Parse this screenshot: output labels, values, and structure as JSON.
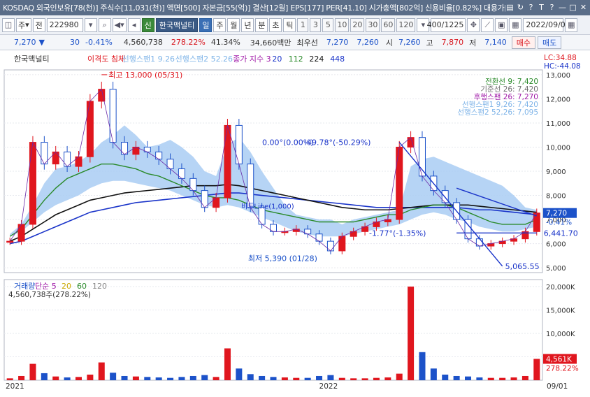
{
  "window": {
    "title": "KOSDAQ 외국인보유[78(천)] 주식수[11,031(천)] 액면[500] 자본금[55(억)] 결산[12월] EPS[177] PER[41.10] 시가총액[802억] 신용비율[0.82%] 대용가[5,470]",
    "buttons": [
      "▤",
      "↻",
      "?",
      "T",
      "?",
      "—",
      "□",
      "✕"
    ]
  },
  "toolbar": {
    "market_select": "주",
    "jeon_label": "전",
    "code": "222980",
    "name_prefix": "신",
    "stock_name": "한국맥널티",
    "periods": [
      "일",
      "주",
      "월",
      "년",
      "분",
      "초",
      "틱"
    ],
    "minute_options": [
      "1",
      "3",
      "5",
      "10",
      "20",
      "30",
      "60",
      "120"
    ],
    "count": "400",
    "count_total": "/1225",
    "date": "2022/09/01"
  },
  "quote": {
    "price": "7,270",
    "change_arrow": "▼",
    "change": "30",
    "change_pct": "-0.41%",
    "volume": "4,560,738",
    "volume_ratio": "278.22%",
    "turnover": "41.34%",
    "amount": "34,660백만",
    "best_label": "최우선",
    "ask": "7,270",
    "bid": "7,260",
    "open_label": "시",
    "open": "7,260",
    "high_label": "고",
    "high": "7,870",
    "low_label": "저",
    "low": "7,140",
    "buy_label": "매수",
    "sell_label": "매도"
  },
  "chart_data": {
    "type": "candlestick",
    "legend": {
      "stock": "한국맥널티",
      "overlays": [
        "이격도 침체",
        "선행스팬1 9.26",
        "선행스팬2 52.26",
        "종가 지수 3",
        "20",
        "112",
        "224",
        "448"
      ]
    },
    "ichimoku_legend": [
      "전환선 9: 7,420",
      "기준선 26: 7,420",
      "후행스팬 26: 7,270",
      "선행스팬1 9,26: 7,420",
      "선행스팬2 52,26: 7,095"
    ],
    "price_axis": {
      "min": 4800,
      "max": 13200,
      "ticks": [
        5000,
        6000,
        7000,
        8000,
        9000,
        10000,
        11000,
        12000,
        13000
      ],
      "tick_labels": [
        "5,000",
        "6,000",
        "7,000",
        "8,000",
        "9,000",
        "10,000",
        "11,000",
        "12,000",
        "13,000"
      ]
    },
    "corner_labels": [
      "LC:34.88",
      "HC:-44.08"
    ],
    "current_price": {
      "value": 7270,
      "label": "7,270",
      "pct": "-0.41%"
    },
    "high_annotation": {
      "label": "최고 13,000 (05/31)",
      "value": 13000,
      "date": "2021/05/31"
    },
    "low_annotation": {
      "label": "최저 5,390 (01/28)",
      "value": 5390,
      "date": "2022/01/28"
    },
    "trendline_labels": [
      "0.00°(0.00%)",
      "-49.78°(-50.29%)",
      "-1.77°(-1.35%)",
      "6,441.70",
      "5,065.55",
      "비트Line(1,000)"
    ],
    "close_series": [
      {
        "date": "2021/01",
        "v": 6100
      },
      {
        "date": "2021/01",
        "v": 6800
      },
      {
        "date": "2021/02",
        "v": 10200
      },
      {
        "date": "2021/02",
        "v": 9300
      },
      {
        "date": "2021/03",
        "v": 9800
      },
      {
        "date": "2021/03",
        "v": 9200
      },
      {
        "date": "2021/04",
        "v": 9600
      },
      {
        "date": "2021/05",
        "v": 11900
      },
      {
        "date": "2021/05",
        "v": 12400
      },
      {
        "date": "2021/06",
        "v": 10200
      },
      {
        "date": "2021/06",
        "v": 9700
      },
      {
        "date": "2021/07",
        "v": 10000
      },
      {
        "date": "2021/07",
        "v": 9800
      },
      {
        "date": "2021/08",
        "v": 9500
      },
      {
        "date": "2021/08",
        "v": 9100
      },
      {
        "date": "2021/09",
        "v": 8700
      },
      {
        "date": "2021/09",
        "v": 8200
      },
      {
        "date": "2021/09",
        "v": 7500
      },
      {
        "date": "2021/10",
        "v": 7900
      },
      {
        "date": "2021/10",
        "v": 10900
      },
      {
        "date": "2021/10",
        "v": 9300
      },
      {
        "date": "2021/11",
        "v": 7500
      },
      {
        "date": "2021/11",
        "v": 6800
      },
      {
        "date": "2021/11",
        "v": 6500
      },
      {
        "date": "2021/12",
        "v": 6500
      },
      {
        "date": "2021/12",
        "v": 6600
      },
      {
        "date": "2021/12",
        "v": 6400
      },
      {
        "date": "2022/01",
        "v": 6100
      },
      {
        "date": "2022/01",
        "v": 5700
      },
      {
        "date": "2022/02",
        "v": 6300
      },
      {
        "date": "2022/02",
        "v": 6500
      },
      {
        "date": "2022/03",
        "v": 6700
      },
      {
        "date": "2022/03",
        "v": 6900
      },
      {
        "date": "2022/04",
        "v": 7000
      },
      {
        "date": "2022/04",
        "v": 10000
      },
      {
        "date": "2022/04",
        "v": 10400
      },
      {
        "date": "2022/05",
        "v": 8800
      },
      {
        "date": "2022/05",
        "v": 8200
      },
      {
        "date": "2022/06",
        "v": 7700
      },
      {
        "date": "2022/06",
        "v": 7000
      },
      {
        "date": "2022/06",
        "v": 6200
      },
      {
        "date": "2022/07",
        "v": 5900
      },
      {
        "date": "2022/07",
        "v": 6000
      },
      {
        "date": "2022/07",
        "v": 6100
      },
      {
        "date": "2022/08",
        "v": 6200
      },
      {
        "date": "2022/08",
        "v": 6500
      },
      {
        "date": "2022/09",
        "v": 7270
      }
    ],
    "cloud_upper": [
      6400,
      6800,
      7600,
      8500,
      9100,
      9200,
      9400,
      9700,
      10200,
      10500,
      10900,
      10500,
      10000,
      10100,
      10300,
      10000,
      9600,
      9000,
      8800,
      10100,
      10400,
      9800,
      9000,
      8300,
      7600,
      7200,
      7100,
      7000,
      7000,
      6800,
      7000,
      7100,
      7200,
      7300,
      7400,
      9200,
      9500,
      9600,
      9400,
      9200,
      9000,
      8800,
      8600,
      8400,
      8000,
      7500,
      7400
    ],
    "cloud_lower": [
      6300,
      6500,
      6900,
      7300,
      7600,
      7800,
      8000,
      8300,
      8500,
      8600,
      8600,
      8500,
      8400,
      8300,
      8200,
      8000,
      7800,
      7600,
      7500,
      7600,
      7500,
      7300,
      7100,
      6900,
      6700,
      6500,
      6400,
      6300,
      6300,
      6300,
      6400,
      6500,
      6600,
      6700,
      6800,
      7000,
      7200,
      7300,
      7200,
      7000,
      6900,
      6700,
      6600,
      6500,
      6500,
      6600,
      6700
    ],
    "ma_green": [
      6300,
      6600,
      7200,
      7800,
      8300,
      8700,
      8900,
      9100,
      9300,
      9300,
      9200,
      9100,
      8900,
      8800,
      8600,
      8400,
      8200,
      8000,
      7900,
      7900,
      7800,
      7600,
      7400,
      7300,
      7200,
      7100,
      7000,
      6900,
      6900,
      6900,
      6900,
      7000,
      7100,
      7200,
      7200,
      7400,
      7500,
      7600,
      7600,
      7500,
      7300,
      7100,
      6900,
      6800,
      6800,
      6800,
      7000
    ],
    "ma_black": [
      6100,
      6300,
      6600,
      6900,
      7200,
      7400,
      7600,
      7800,
      7900,
      8000,
      8100,
      8150,
      8200,
      8250,
      8300,
      8350,
      8400,
      8400,
      8400,
      8450,
      8400,
      8300,
      8200,
      8100,
      8000,
      7900,
      7800,
      7700,
      7600,
      7500,
      7450,
      7400,
      7400,
      7400,
      7450,
      7500,
      7550,
      7600,
      7600,
      7600,
      7600,
      7550,
      7500,
      7450,
      7400,
      7350,
      7300
    ],
    "ma_blue": [
      6000,
      6100,
      6300,
      6500,
      6700,
      6900,
      7100,
      7300,
      7400,
      7500,
      7600,
      7700,
      7750,
      7800,
      7850,
      7900,
      7950,
      8000,
      8050,
      8100,
      8100,
      8050,
      8000,
      7950,
      7900,
      7850,
      7800,
      7750,
      7700,
      7650,
      7600,
      7550,
      7500,
      7500,
      7500,
      7500,
      7500,
      7500,
      7500,
      7500,
      7450,
      7400,
      7400,
      7350,
      7300,
      7250,
      7200
    ],
    "volume": {
      "legend": [
        "거래량",
        "단순 5",
        "20",
        "60",
        "120"
      ],
      "current_label": "4,560,738주(278.22%)",
      "axis_ticks": [
        5000000,
        10000000,
        15000000,
        20000000
      ],
      "axis_labels": [
        "5,000K",
        "10,000K",
        "15,000K",
        "20,000K"
      ],
      "max": 21500000,
      "current_tag": "4,561K",
      "current_pct": "278.22%",
      "values": [
        400000,
        900000,
        3500000,
        1500000,
        800000,
        600000,
        700000,
        1200000,
        3800000,
        1600000,
        900000,
        800000,
        700000,
        600000,
        500000,
        700000,
        900000,
        1100000,
        700000,
        6800000,
        2500000,
        1300000,
        900000,
        700000,
        600000,
        500000,
        500000,
        900000,
        1100000,
        500000,
        400000,
        400000,
        500000,
        600000,
        1400000,
        20000000,
        6000000,
        2500000,
        1200000,
        900000,
        800000,
        600000,
        500000,
        500000,
        600000,
        900000,
        4560738
      ]
    },
    "x_axis": {
      "labels": [
        "2021",
        "2022",
        "09/01"
      ]
    }
  }
}
